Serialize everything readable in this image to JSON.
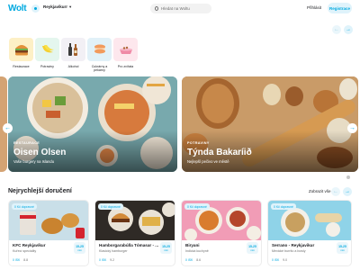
{
  "header": {
    "logo": "Wolt",
    "location": "Reykjavíkurr",
    "search_placeholder": "Hledat na Woltu",
    "login": "Přihlásit",
    "signup": "Registrace"
  },
  "categories": [
    {
      "label": "Restaurace",
      "color": "#fdf0c6"
    },
    {
      "label": "Potraviny",
      "color": "#e4f6ee"
    },
    {
      "label": "Alkohol",
      "color": "#f2f0f5"
    },
    {
      "label": "Cukrárny a pekárny",
      "color": "#e1f1f8"
    },
    {
      "label": "Pro zvířata",
      "color": "#fde7ed"
    }
  ],
  "heroes": [
    {
      "tag": "RESTAURACE",
      "title": "Oisen Olsen",
      "subtitle": "Vaše burgery na Islandu"
    },
    {
      "tag": "POTRAVINY",
      "title": "Týnda Bakaríið",
      "subtitle": "Nejlepší pečivo ve městě"
    }
  ],
  "section": {
    "title": "Nejrychlejší doručení",
    "see_all": "Zobrazit vše"
  },
  "cards": [
    {
      "badge": "0 Kč dopravné",
      "name": "KFC Reykjavíkur",
      "sub": "Kuřecí speciality",
      "eta_time": "15-25",
      "eta_unit": "min",
      "fee": "0 ISK",
      "rating": "8.8"
    },
    {
      "badge": "0 Kč dopravné",
      "name": "Hamborgarabúlla Tómasar - ...",
      "sub": "Klasický hamburger",
      "eta_time": "15-25",
      "eta_unit": "min",
      "fee": "0 ISK",
      "rating": "9.2"
    },
    {
      "badge": "0 Kč dopravné",
      "name": "Biryani",
      "sub": "Indická kuchyně",
      "eta_time": "15-25",
      "eta_unit": "min",
      "fee": "0 ISK",
      "rating": "8.6"
    },
    {
      "badge": "0 Kč dopravné",
      "name": "Serrano - Reykjavikur",
      "sub": "Mexické burrito a bowly",
      "eta_time": "15-25",
      "eta_unit": "min",
      "fee": "0 ISK",
      "rating": "9.0"
    }
  ],
  "colors": {
    "accent": "#00a9e0",
    "accent_light": "#dff3fb"
  }
}
